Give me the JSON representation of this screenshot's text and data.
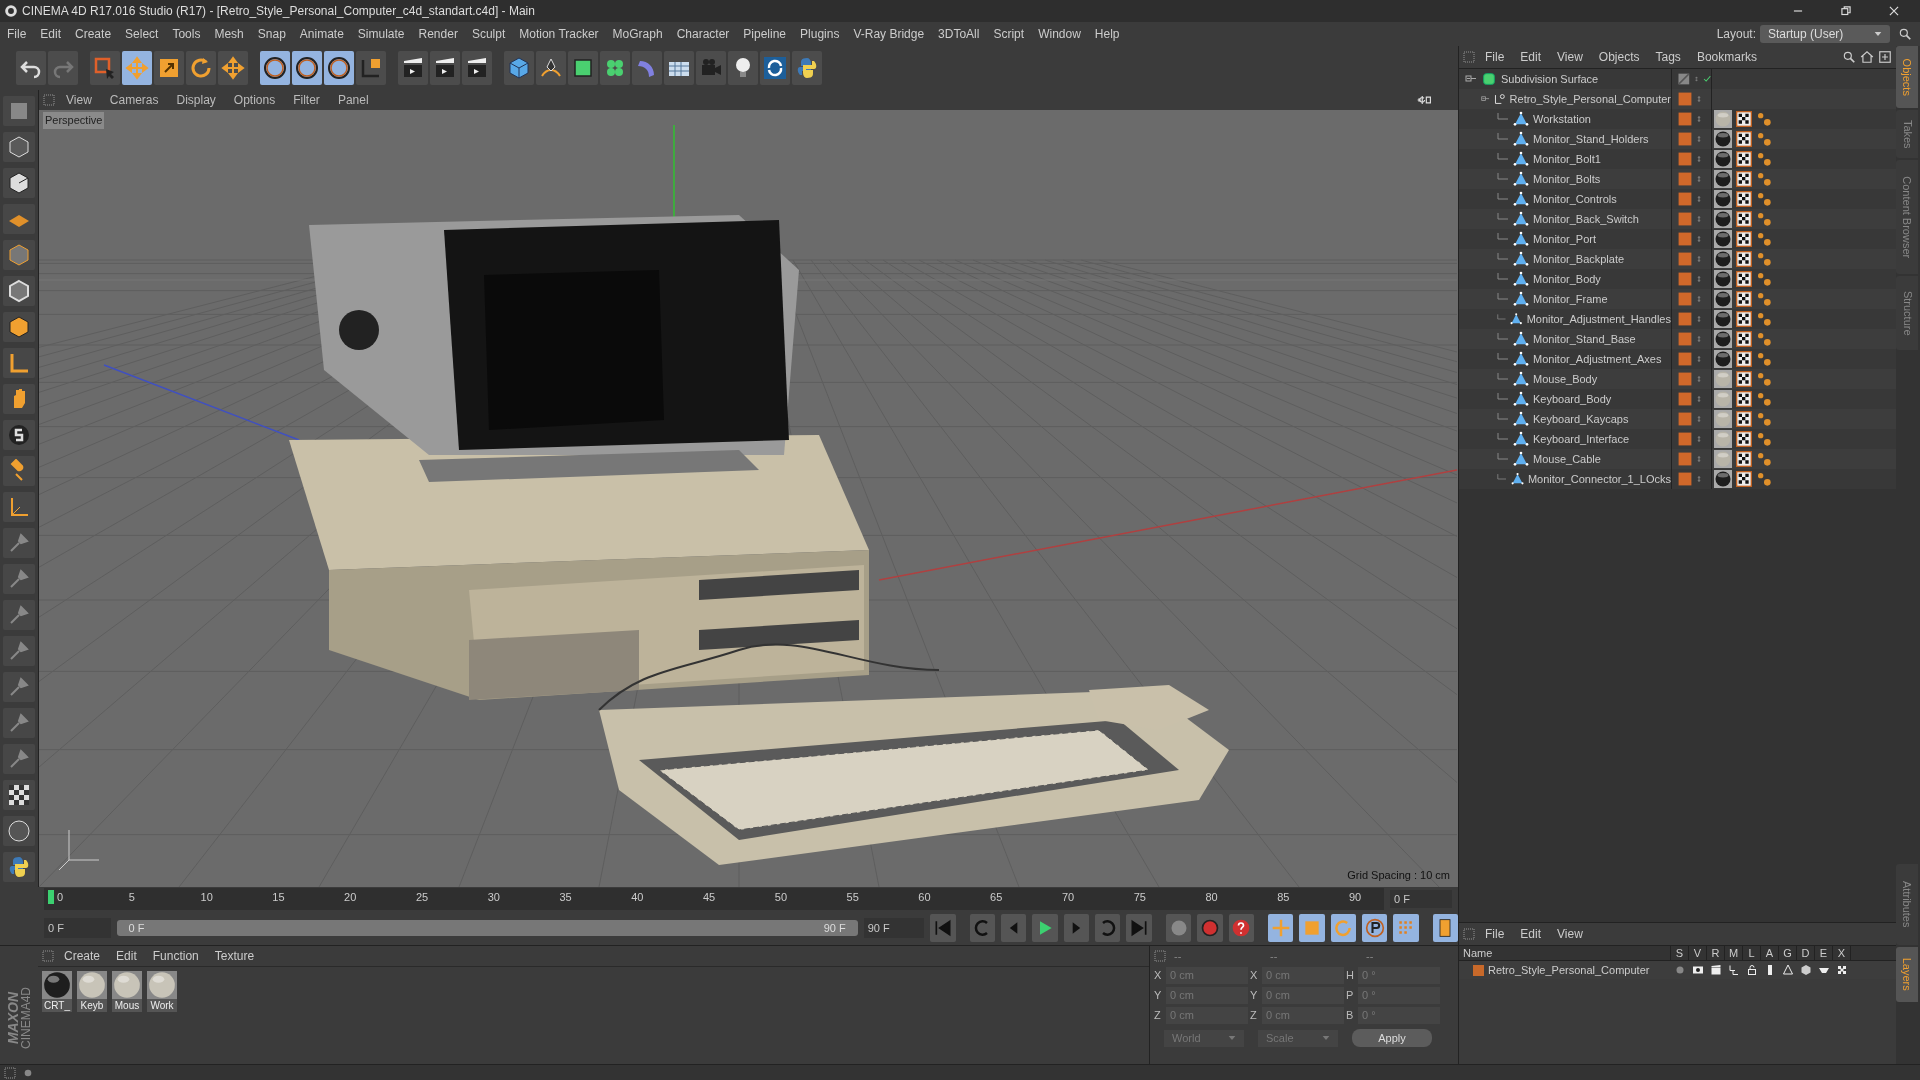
{
  "window": {
    "title": "CINEMA 4D R17.016 Studio (R17) - [Retro_Style_Personal_Computer_c4d_standart.c4d] - Main"
  },
  "menu": [
    "File",
    "Edit",
    "Create",
    "Select",
    "Tools",
    "Mesh",
    "Snap",
    "Animate",
    "Simulate",
    "Render",
    "Sculpt",
    "Motion Tracker",
    "MoGraph",
    "Character",
    "Pipeline",
    "Plugins",
    "V-Ray Bridge",
    "3DToAll",
    "Script",
    "Window",
    "Help"
  ],
  "layout": {
    "label": "Layout:",
    "value": "Startup (User)"
  },
  "toolbar": [
    {
      "kind": "undo",
      "selected": false
    },
    {
      "kind": "redo",
      "selected": false
    },
    {
      "kind": "select",
      "selected": false
    },
    {
      "kind": "move",
      "selected": true
    },
    {
      "kind": "scale",
      "selected": false
    },
    {
      "kind": "rotate",
      "selected": false
    },
    {
      "kind": "move",
      "selected": false
    },
    {
      "kind": "x",
      "selected": true
    },
    {
      "kind": "y",
      "selected": true
    },
    {
      "kind": "z",
      "selected": true
    },
    {
      "kind": "coord",
      "selected": false
    },
    {
      "kind": "render",
      "selected": false
    },
    {
      "kind": "render",
      "selected": false
    },
    {
      "kind": "render",
      "selected": false
    },
    {
      "kind": "cube",
      "selected": false
    },
    {
      "kind": "pen",
      "selected": false
    },
    {
      "kind": "subdiv",
      "selected": false
    },
    {
      "kind": "cloner",
      "selected": false
    },
    {
      "kind": "deformer",
      "selected": false
    },
    {
      "kind": "floor",
      "selected": false
    },
    {
      "kind": "camera",
      "selected": false
    },
    {
      "kind": "light",
      "selected": false
    },
    {
      "kind": "sketch",
      "selected": false
    },
    {
      "kind": "python",
      "selected": false
    }
  ],
  "viewport": {
    "menu": [
      "View",
      "Cameras",
      "Display",
      "Options",
      "Filter",
      "Panel"
    ],
    "label": "Perspective",
    "grid_spacing": "Grid Spacing : 10 cm"
  },
  "timeline": {
    "ticks": [
      "0",
      "5",
      "10",
      "15",
      "20",
      "25",
      "30",
      "35",
      "40",
      "45",
      "50",
      "55",
      "60",
      "65",
      "70",
      "75",
      "80",
      "85",
      "90"
    ],
    "current": "0 F",
    "start": "0 F",
    "range": {
      "start": "0 F",
      "end": "90 F",
      "level": 1
    },
    "end": "90 F"
  },
  "materials": {
    "menu": [
      "Create",
      "Edit",
      "Function",
      "Texture"
    ],
    "items": [
      {
        "name": "CRT_",
        "kind": "dark"
      },
      {
        "name": "Keyb",
        "kind": "light"
      },
      {
        "name": "Mous",
        "kind": "light"
      },
      {
        "name": "Work",
        "kind": "light"
      }
    ]
  },
  "coordinates": {
    "headers": [
      "--",
      "--",
      "--"
    ],
    "rows": [
      {
        "a": "X",
        "a_value": "0 cm",
        "b": "X",
        "b_value": "0 cm",
        "c": "H",
        "c_value": "0 °"
      },
      {
        "a": "Y",
        "a_value": "0 cm",
        "b": "Y",
        "b_value": "0 cm",
        "c": "P",
        "c_value": "0 °"
      },
      {
        "a": "Z",
        "a_value": "0 cm",
        "b": "Z",
        "b_value": "0 cm",
        "c": "B",
        "c_value": "0 °"
      }
    ],
    "mode": "World",
    "transform": "Scale",
    "apply": "Apply"
  },
  "objects": {
    "menu": [
      "File",
      "Edit",
      "View",
      "Objects",
      "Tags",
      "Bookmarks"
    ],
    "tree": [
      {
        "name": "Subdivision Surface",
        "kind": "subdivision",
        "children": [
          {
            "name": "Retro_Style_Personal_Computer",
            "kind": "null",
            "children": [
              {
                "name": "Workstation",
                "kind": "light"
              },
              {
                "name": "Monitor_Stand_Holders",
                "kind": "dark"
              },
              {
                "name": "Monitor_Bolt1",
                "kind": "dark"
              },
              {
                "name": "Monitor_Bolts",
                "kind": "dark"
              },
              {
                "name": "Monitor_Controls",
                "kind": "dark"
              },
              {
                "name": "Monitor_Back_Switch",
                "kind": "dark"
              },
              {
                "name": "Monitor_Port",
                "kind": "dark"
              },
              {
                "name": "Monitor_Backplate",
                "kind": "dark"
              },
              {
                "name": "Monitor_Body",
                "kind": "dark"
              },
              {
                "name": "Monitor_Frame",
                "kind": "dark"
              },
              {
                "name": "Monitor_Adjustment_Handles",
                "kind": "dark"
              },
              {
                "name": "Monitor_Stand_Base",
                "kind": "dark"
              },
              {
                "name": "Monitor_Adjustment_Axes",
                "kind": "dark"
              },
              {
                "name": "Mouse_Body",
                "kind": "light"
              },
              {
                "name": "Keyboard_Body",
                "kind": "light"
              },
              {
                "name": "Keyboard_Kaycaps",
                "kind": "light"
              },
              {
                "name": "Keyboard_Interface",
                "kind": "light"
              },
              {
                "name": "Mouse_Cable",
                "kind": "light"
              },
              {
                "name": "Monitor_Connector_1_LOcks",
                "kind": "dark"
              }
            ]
          }
        ]
      }
    ]
  },
  "layers": {
    "menu": [
      "File",
      "Edit",
      "View"
    ],
    "columns": [
      "Name",
      "S",
      "V",
      "R",
      "M",
      "L",
      "A",
      "G",
      "D",
      "E",
      "X"
    ],
    "rows": [
      {
        "name": "Retro_Style_Personal_Computer",
        "color": "#c8692a"
      }
    ]
  },
  "side_tabs": [
    {
      "label": "Objects",
      "selected": true
    },
    {
      "label": "Takes",
      "selected": false
    },
    {
      "label": "Content Browser",
      "selected": false
    },
    {
      "label": "Structure",
      "selected": false
    }
  ],
  "side_tabs_bottom": [
    {
      "label": "Attributes",
      "selected": false
    },
    {
      "label": "Layers",
      "selected": true
    }
  ],
  "brand": {
    "line1": "MAXON",
    "line2": "CINEMA4D"
  }
}
